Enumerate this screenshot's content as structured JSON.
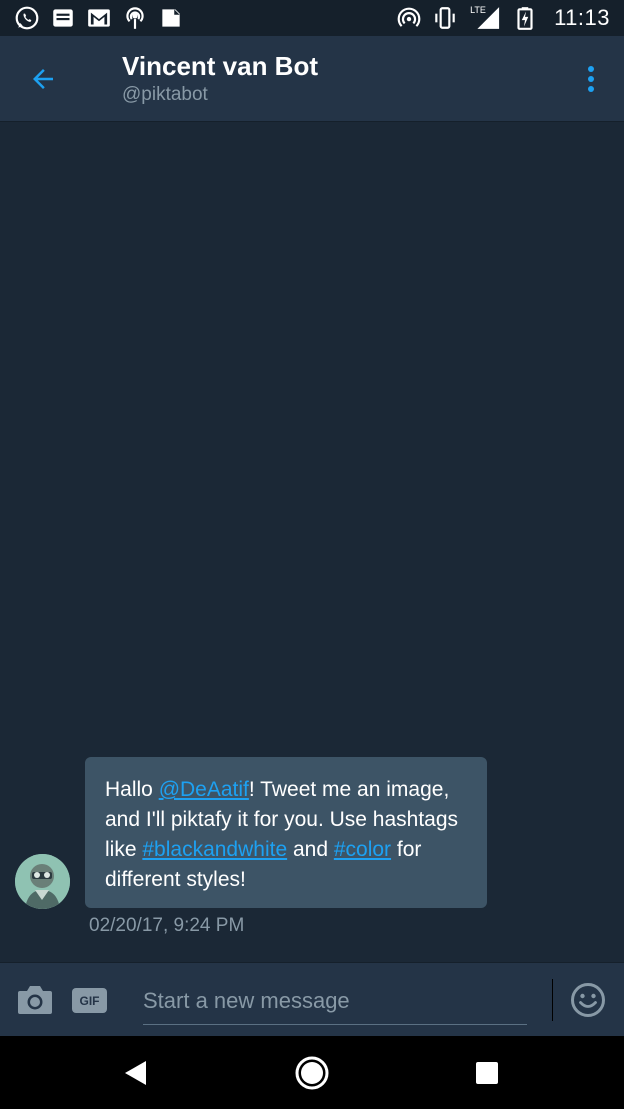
{
  "status_bar": {
    "time": "11:13",
    "network_label": "LTE",
    "icons": [
      "whatsapp-icon",
      "messages-icon",
      "gmail-icon",
      "podcast-icon",
      "feedly-icon",
      "hotspot-icon",
      "vibrate-icon",
      "signal-icon",
      "battery-charging-icon"
    ]
  },
  "header": {
    "title": "Vincent van Bot",
    "handle": "@piktabot"
  },
  "message": {
    "part1": "Hallo ",
    "mention": "@DeAatif",
    "part2": "! Tweet me an image, and I'll piktafy it for you. Use hashtags like ",
    "hashtag1": "#blackandwhite",
    "part3": " and ",
    "hashtag2": "#color",
    "part4": " for different styles!",
    "timestamp": "02/20/17, 9:24 PM"
  },
  "composer": {
    "placeholder": "Start a new message",
    "gif_label": "GIF"
  },
  "colors": {
    "background": "#1b2836",
    "app_bar": "#243447",
    "bubble": "#3d5466",
    "accent": "#1da1f2",
    "secondary_text": "#8899a6"
  }
}
